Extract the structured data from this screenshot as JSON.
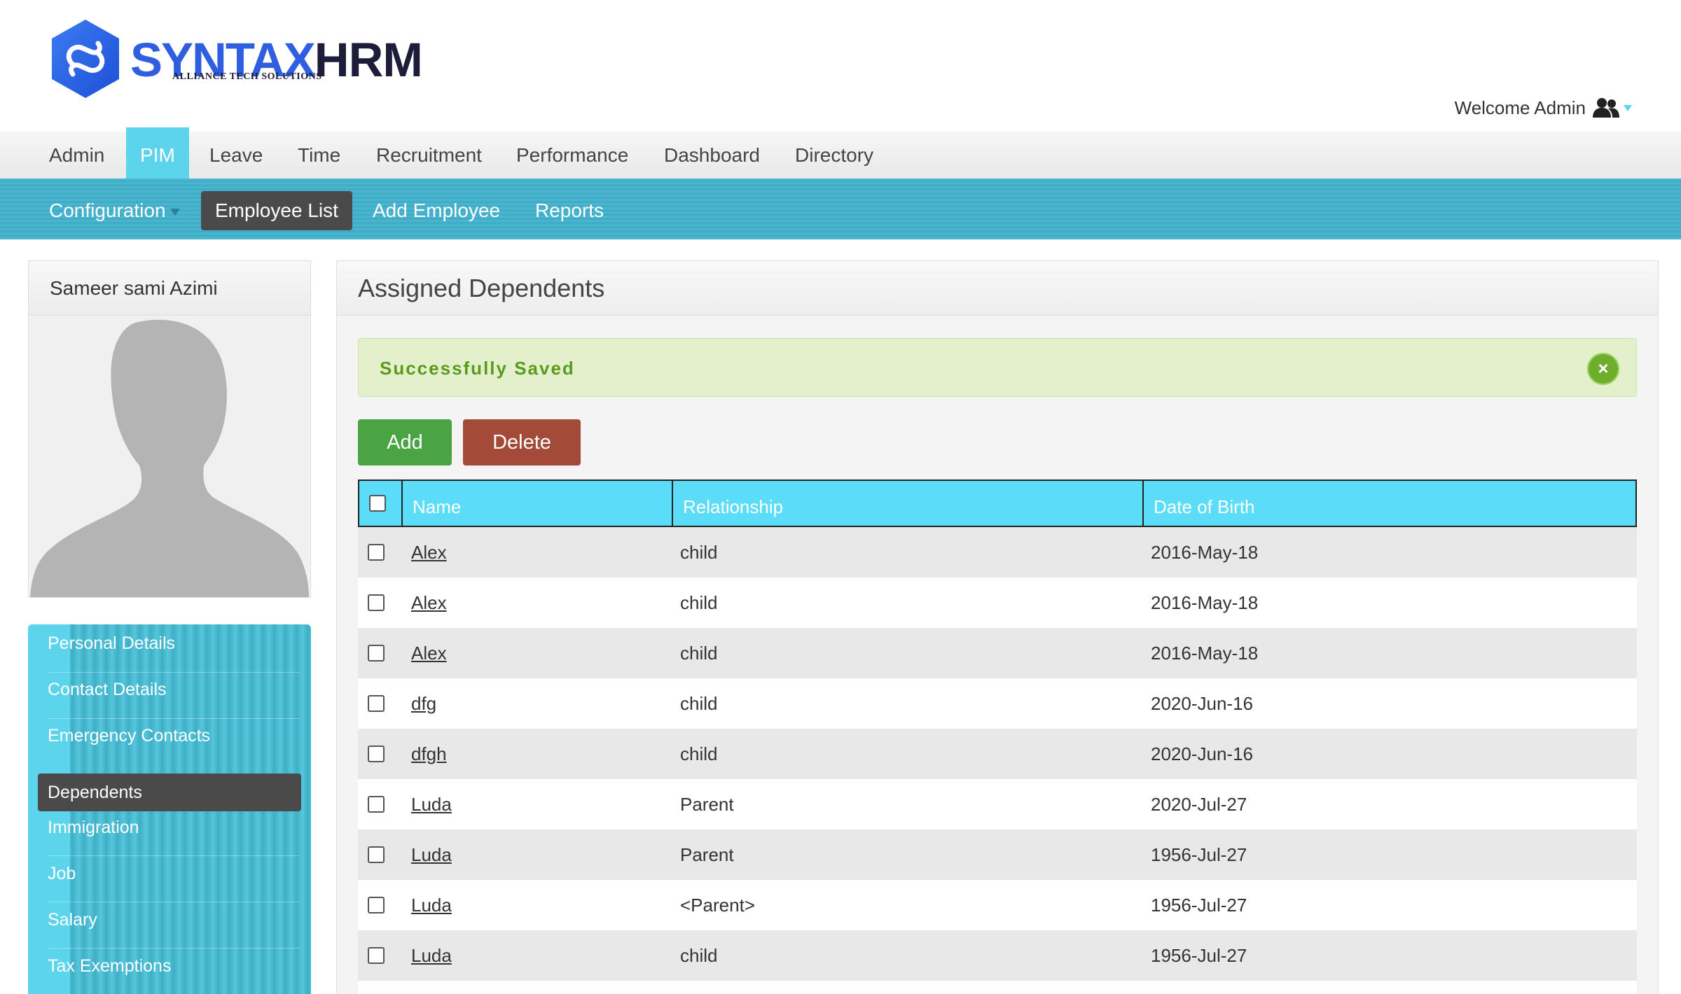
{
  "branding": {
    "logo_word1": "SYNTAX",
    "logo_word2": "HRM",
    "logo_subtitle": "ALLIANCE TECH SOLUTIONS",
    "welcome": "Welcome Admin",
    "welcome_icon": "users-icon"
  },
  "main_menu": [
    "Admin",
    "PIM",
    "Leave",
    "Time",
    "Recruitment",
    "Performance",
    "Dashboard",
    "Directory"
  ],
  "main_menu_active": "PIM",
  "sub_menu": {
    "configuration": "Configuration",
    "employee_list": "Employee List",
    "add_employee": "Add Employee",
    "reports": "Reports",
    "active": "Employee List"
  },
  "profile": {
    "name": "Sameer sami Azimi"
  },
  "side_nav": {
    "items": [
      "Personal Details",
      "Contact Details",
      "Emergency Contacts",
      "Dependents",
      "Immigration",
      "Job",
      "Salary",
      "Tax Exemptions"
    ],
    "active": "Dependents"
  },
  "main": {
    "title": "Assigned Dependents",
    "message": "Successfully Saved",
    "message_close": "×",
    "add_label": "Add",
    "delete_label": "Delete"
  },
  "table": {
    "columns": [
      "Name",
      "Relationship",
      "Date of Birth"
    ],
    "rows": [
      {
        "name": "Alex",
        "relationship": "child",
        "dob": "2016-May-18"
      },
      {
        "name": "Alex",
        "relationship": "child",
        "dob": "2016-May-18"
      },
      {
        "name": "Alex",
        "relationship": "child",
        "dob": "2016-May-18"
      },
      {
        "name": "dfg",
        "relationship": "child",
        "dob": "2020-Jun-16"
      },
      {
        "name": "dfgh",
        "relationship": "child",
        "dob": "2020-Jun-16"
      },
      {
        "name": "Luda",
        "relationship": "Parent",
        "dob": "2020-Jul-27"
      },
      {
        "name": "Luda",
        "relationship": "Parent",
        "dob": "1956-Jul-27"
      },
      {
        "name": "Luda",
        "relationship": "<Parent>",
        "dob": "1956-Jul-27"
      },
      {
        "name": "Luda",
        "relationship": "child",
        "dob": "1956-Jul-27"
      }
    ]
  },
  "colors": {
    "accent": "#5bd4ec",
    "submenu": "#45b0ca",
    "add_button": "#4aa444",
    "delete_button": "#a34a38",
    "success_bg": "#e4f0cb",
    "success_text": "#5a9a1c"
  }
}
